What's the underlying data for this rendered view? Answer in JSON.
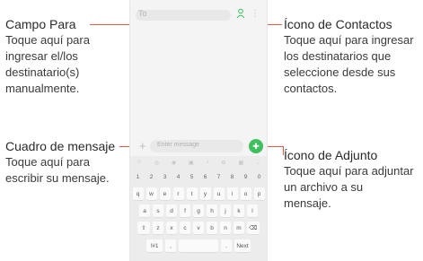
{
  "left_annotations": [
    {
      "title": "Campo Para",
      "lines": [
        "Toque aquí para",
        "ingresar el/los",
        "destinatario(s)",
        "manualmente."
      ]
    },
    {
      "title": "Cuadro de mensaje",
      "lines": [
        "Toque aquí para",
        "escribir su mensaje."
      ]
    }
  ],
  "right_annotations": [
    {
      "title": "Ícono de Contactos",
      "lines": [
        "Toque aquí para ingresar",
        "los destinatarios que",
        "seleccione desde sus",
        "contactos."
      ]
    },
    {
      "title": "Ícono de Adjunto",
      "lines": [
        "Toque aquí para adjuntar",
        "un archivo a su",
        "mensaje."
      ]
    }
  ],
  "phone": {
    "to_label": "To",
    "message_placeholder": "Enter message",
    "keyboard": {
      "numbers": [
        "1",
        "2",
        "3",
        "4",
        "5",
        "6",
        "7",
        "8",
        "9",
        "0"
      ],
      "row1": [
        "q",
        "w",
        "e",
        "r",
        "t",
        "y",
        "u",
        "i",
        "o",
        "p"
      ],
      "row2": [
        "a",
        "s",
        "d",
        "f",
        "g",
        "h",
        "j",
        "k",
        "l"
      ],
      "row3": [
        "⇧",
        "z",
        "x",
        "c",
        "v",
        "b",
        "n",
        "m",
        "⌫"
      ],
      "bottom": {
        "sym": "!#1",
        "comma": ",",
        "space": "",
        "period": ".",
        "next": "Next"
      }
    }
  },
  "colors": {
    "callout": "#e05a4f",
    "send": "#3fbf5e"
  }
}
